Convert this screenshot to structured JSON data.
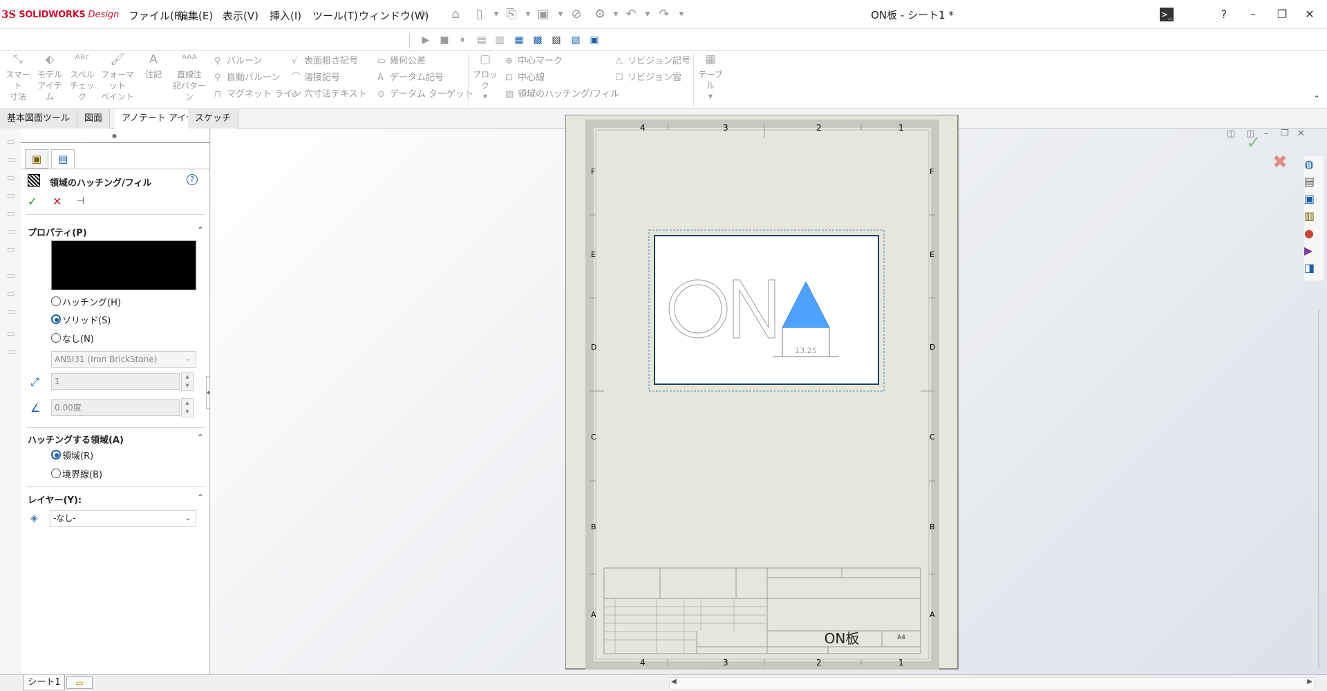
{
  "app": {
    "brand_ds": "3S",
    "brand_name": "SOLIDWORKS",
    "brand_suffix": "Design",
    "document_title": "ON板 - シート1 *"
  },
  "menu": [
    "ファイル(F)",
    "編集(E)",
    "表示(V)",
    "挿入(I)",
    "ツール(T)",
    "ウィンドウ(W)"
  ],
  "command_manager": {
    "smart_dimension": "スマート\n寸法",
    "model_items": "モデル\nアイテム",
    "spell_check": "スペル\nチェック",
    "format_painter": "フォーマット\nペイント",
    "note": "注記",
    "linear_note_pattern": "直線注\n記パターン",
    "balloon": "バルーン",
    "auto_balloon": "自動バルーン",
    "magnetic_line": "マグネット ライン",
    "surface_finish": "表面粗さ記号",
    "weld_symbol": "溶接記号",
    "hole_callout": "穴寸法テキスト",
    "geometric_tolerance": "幾何公差",
    "datum_feature": "データム記号",
    "datum_target": "データム ターゲット",
    "block": "ブロック",
    "center_mark": "中心マーク",
    "centerline": "中心線",
    "area_hatch": "領域のハッチング/フィル",
    "revision_symbol": "リビジョン記号",
    "revision_cloud": "リビジョン雲",
    "table": "テーブル"
  },
  "tabs": [
    "基本図面ツール",
    "図面",
    "アノテート アイテム",
    "スケッチ"
  ],
  "property_manager": {
    "title": "領域のハッチング/フィル",
    "properties_header": "プロパティ(P)",
    "fill_color": "#000000",
    "radio_hatch": "ハッチング(H)",
    "radio_solid": "ソリッド(S)",
    "radio_none": "なし(N)",
    "pattern_value": "ANSI31 (Iron BrickStone)",
    "scale_value": "1",
    "angle_value": "0.00度",
    "hatch_area_header": "ハッチングする領域(A)",
    "radio_region": "領域(R)",
    "radio_boundary": "境界線(B)",
    "layer_header": "レイヤー(Y):",
    "layer_value": "-なし-"
  },
  "sheet": {
    "col_labels_top": [
      "4",
      "3",
      "2",
      "1"
    ],
    "col_labels_bottom": [
      "4",
      "3",
      "2",
      "1"
    ],
    "row_labels": [
      "F",
      "E",
      "D",
      "C",
      "B",
      "A"
    ],
    "view_text": "ON",
    "dimension_value": "13.25",
    "triangle_color": "#4da3ff",
    "title_block_name": "ON板",
    "sheet_size": "A4"
  },
  "bottom": {
    "sheet_tab": "シート1"
  }
}
